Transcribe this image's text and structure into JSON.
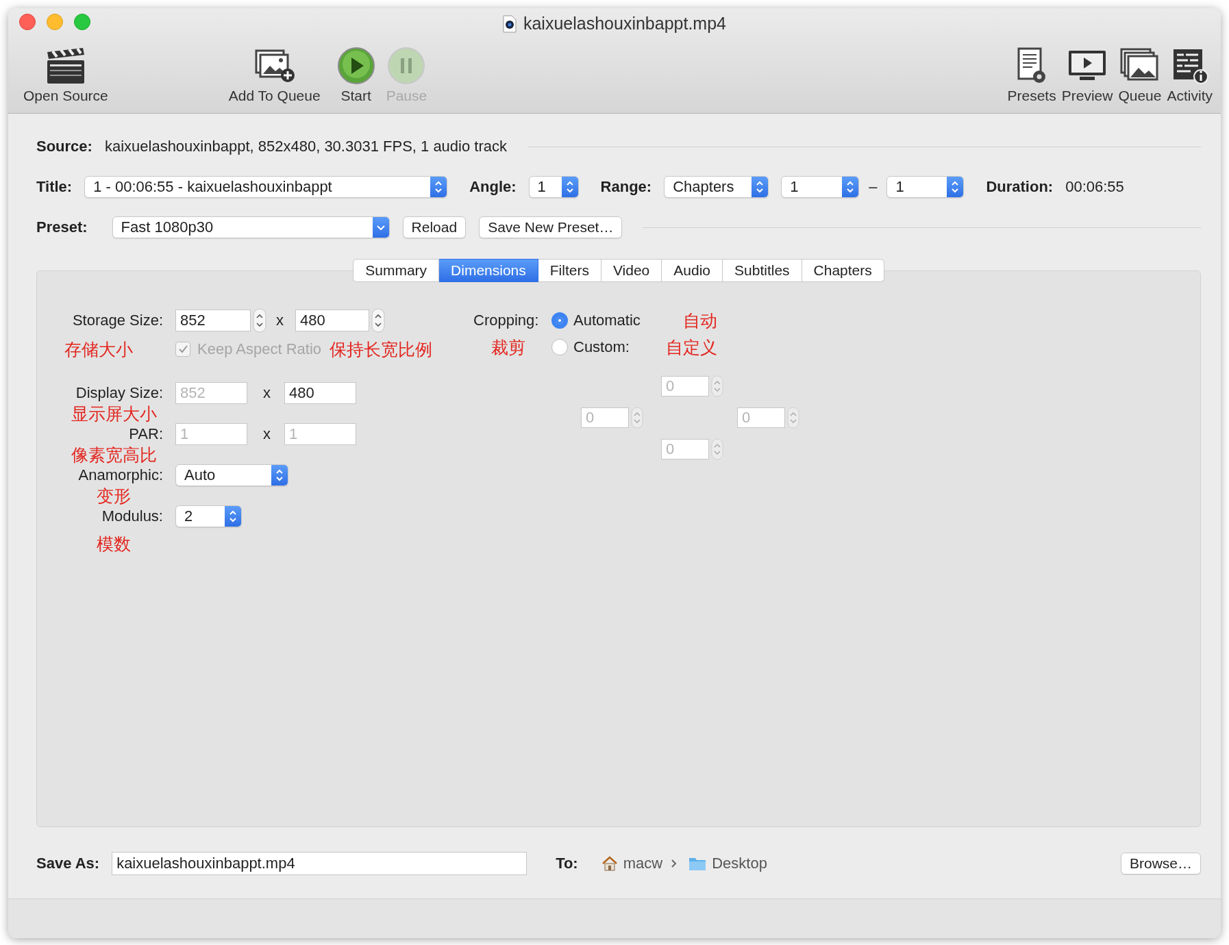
{
  "window": {
    "title": "kaixuelashouxinbappt.mp4"
  },
  "toolbar": {
    "left": [
      {
        "label": "Open Source",
        "kind": "clapper",
        "disabled": false
      },
      {
        "label": "Add To Queue",
        "kind": "add-queue",
        "disabled": false
      },
      {
        "label": "Start",
        "kind": "start",
        "disabled": false
      },
      {
        "label": "Pause",
        "kind": "pause",
        "disabled": true
      }
    ],
    "right": [
      {
        "label": "Presets",
        "kind": "presets",
        "disabled": false
      },
      {
        "label": "Preview",
        "kind": "preview",
        "disabled": false
      },
      {
        "label": "Queue",
        "kind": "queue",
        "disabled": false
      },
      {
        "label": "Activity",
        "kind": "activity",
        "disabled": false
      }
    ]
  },
  "source": {
    "label": "Source:",
    "value": "kaixuelashouxinbappt, 852x480, 30.3031 FPS, 1 audio track"
  },
  "title_row": {
    "title_label": "Title:",
    "title_value": "1 - 00:06:55 - kaixuelashouxinbappt",
    "angle_label": "Angle:",
    "angle_value": "1",
    "range_label": "Range:",
    "range_value": "Chapters",
    "range_from": "1",
    "range_dash": "–",
    "range_to": "1",
    "duration_label": "Duration:",
    "duration_value": "00:06:55"
  },
  "preset_row": {
    "label": "Preset:",
    "value": "Fast 1080p30",
    "buttons": [
      "Reload",
      "Save New Preset…"
    ]
  },
  "tabs": [
    {
      "label": "Summary",
      "selected": false
    },
    {
      "label": "Dimensions",
      "selected": true
    },
    {
      "label": "Filters",
      "selected": false
    },
    {
      "label": "Video",
      "selected": false
    },
    {
      "label": "Audio",
      "selected": false
    },
    {
      "label": "Subtitles",
      "selected": false
    },
    {
      "label": "Chapters",
      "selected": false
    }
  ],
  "dimensions": {
    "storage": {
      "label": "Storage Size:",
      "width": {
        "value": "852",
        "disabled": false
      },
      "times": "x",
      "height": {
        "value": "480",
        "disabled": false
      },
      "annotation": "存储大小"
    },
    "keep_aspect": {
      "label": "Keep Aspect Ratio",
      "checked": true,
      "disabled": true,
      "annotation": "保持长宽比例"
    },
    "display": {
      "label": "Display Size:",
      "width": {
        "value": "852",
        "disabled": true
      },
      "times": "x",
      "height": {
        "value": "480",
        "disabled": false
      },
      "annotation": "显示屏大小"
    },
    "par": {
      "label": "PAR:",
      "width": {
        "value": "1",
        "disabled": true
      },
      "times": "x",
      "height": {
        "value": "1",
        "disabled": true
      },
      "annotation": "像素宽高比"
    },
    "anamorphic": {
      "label": "Anamorphic:",
      "value": "Auto",
      "annotation": "变形"
    },
    "modulus": {
      "label": "Modulus:",
      "value": "2",
      "annotation": "模数"
    }
  },
  "cropping": {
    "label": "Cropping:",
    "annotation": "裁剪",
    "options": [
      {
        "label": "Automatic",
        "selected": true,
        "annotation": "自动"
      },
      {
        "label": "Custom:",
        "selected": false,
        "annotation": "自定义"
      }
    ],
    "top": {
      "value": "0",
      "disabled": true
    },
    "left": {
      "value": "0",
      "disabled": true
    },
    "right": {
      "value": "0",
      "disabled": true
    },
    "bottom": {
      "value": "0",
      "disabled": true
    }
  },
  "save": {
    "label": "Save As:",
    "value": "kaixuelashouxinbappt.mp4",
    "to_label": "To:",
    "path": [
      {
        "label": "macw",
        "kind": "home"
      },
      {
        "label": "Desktop",
        "kind": "folder"
      }
    ],
    "browse": "Browse…"
  }
}
